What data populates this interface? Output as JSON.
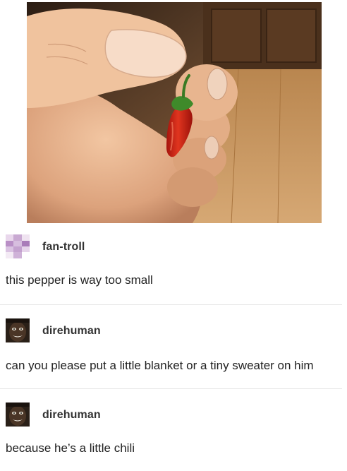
{
  "posts": [
    {
      "username": "fan-troll",
      "text": "this pepper is way too small",
      "avatar": "pixelated-avatar-icon"
    },
    {
      "username": "direhuman",
      "text": "can you please put a little blanket or a tiny sweater on him",
      "avatar": "dark-face-avatar-icon"
    },
    {
      "username": "direhuman",
      "text": "because he’s a little chili",
      "avatar": "dark-face-avatar-icon"
    }
  ],
  "colors": {
    "pepper": "#c8251a",
    "stem": "#3f8a2a",
    "skin": "#e8b58f",
    "wood": "#c08a52"
  }
}
